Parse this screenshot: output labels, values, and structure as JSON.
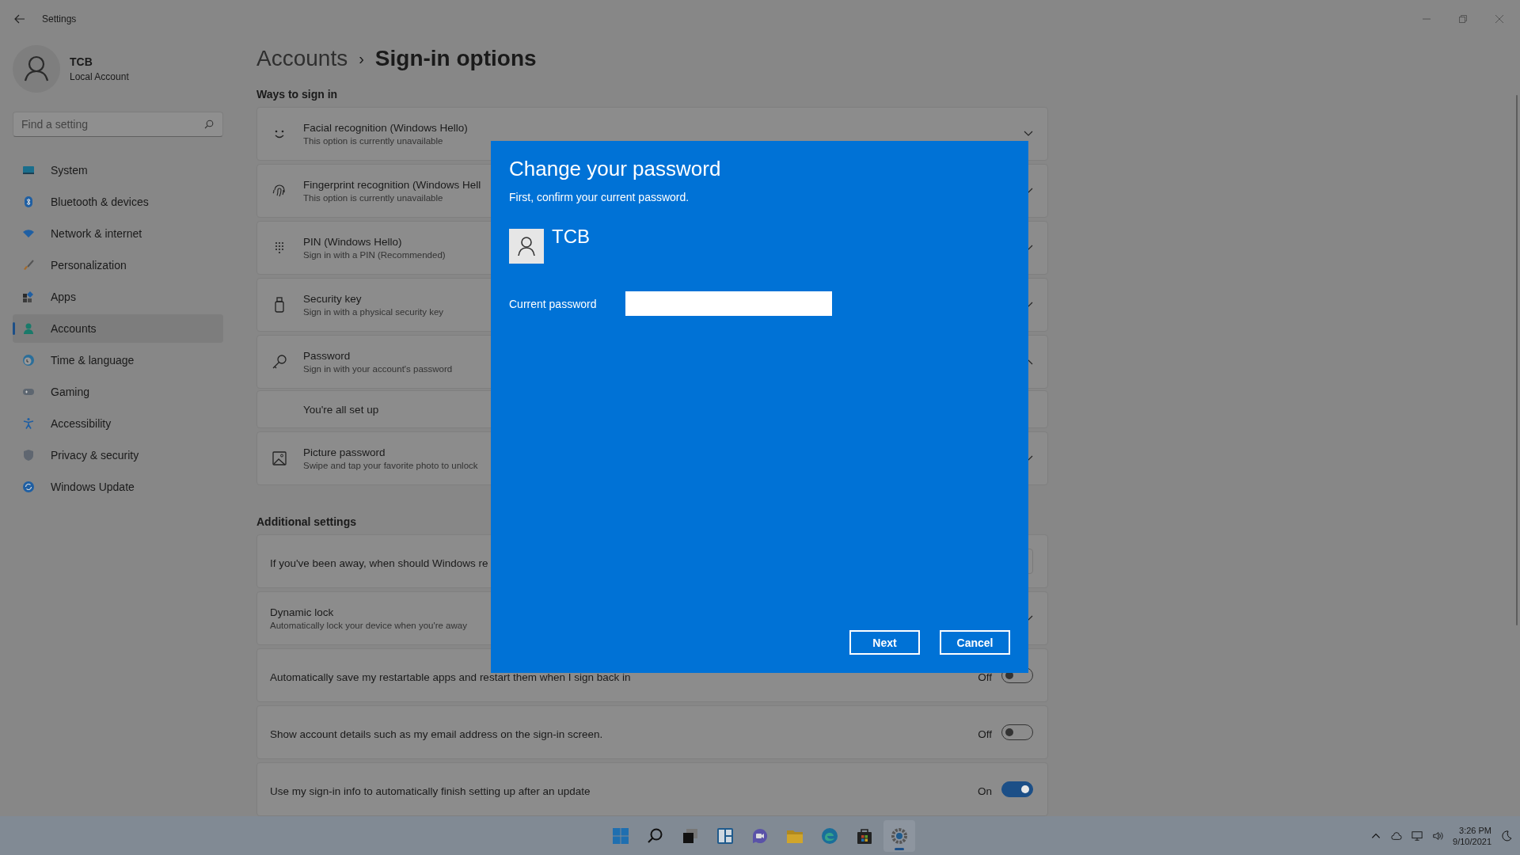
{
  "window": {
    "title": "Settings"
  },
  "profile": {
    "name": "TCB",
    "account_type": "Local Account"
  },
  "search": {
    "placeholder": "Find a setting"
  },
  "nav": [
    {
      "label": "System",
      "kind": "system",
      "selected": false
    },
    {
      "label": "Bluetooth & devices",
      "kind": "bluetooth",
      "selected": false
    },
    {
      "label": "Network & internet",
      "kind": "network",
      "selected": false
    },
    {
      "label": "Personalization",
      "kind": "brush",
      "selected": false
    },
    {
      "label": "Apps",
      "kind": "apps",
      "selected": false
    },
    {
      "label": "Accounts",
      "kind": "accounts",
      "selected": true
    },
    {
      "label": "Time & language",
      "kind": "time",
      "selected": false
    },
    {
      "label": "Gaming",
      "kind": "gaming",
      "selected": false
    },
    {
      "label": "Accessibility",
      "kind": "accessibility",
      "selected": false
    },
    {
      "label": "Privacy & security",
      "kind": "shield",
      "selected": false
    },
    {
      "label": "Windows Update",
      "kind": "update",
      "selected": false
    }
  ],
  "breadcrumb": {
    "parent": "Accounts",
    "separator": "›",
    "current": "Sign-in options"
  },
  "ways_to_sign_in": {
    "heading": "Ways to sign in",
    "options": [
      {
        "kind": "face",
        "title": "Facial recognition (Windows Hello)",
        "subtitle": "This option is currently unavailable",
        "expanded": false
      },
      {
        "kind": "fingerprint",
        "title": "Fingerprint recognition (Windows Hell",
        "subtitle": "This option is currently unavailable",
        "expanded": false
      },
      {
        "kind": "pin",
        "title": "PIN (Windows Hello)",
        "subtitle": "Sign in with a PIN (Recommended)",
        "expanded": false
      },
      {
        "kind": "key",
        "title": "Security key",
        "subtitle": "Sign in with a physical security key",
        "expanded": false
      },
      {
        "kind": "password",
        "title": "Password",
        "subtitle": "Sign in with your account's password",
        "expanded": true,
        "detail": "You're all set up"
      },
      {
        "kind": "picture",
        "title": "Picture password",
        "subtitle": "Swipe and tap your favorite photo to unlock",
        "expanded": false
      }
    ]
  },
  "additional_settings": {
    "heading": "Additional settings",
    "rows": [
      {
        "kind": "dropdown",
        "label": "If you've been away, when should Windows re"
      },
      {
        "kind": "expander",
        "title": "Dynamic lock",
        "subtitle": "Automatically lock your device when you're away",
        "expanded": false
      },
      {
        "kind": "toggle",
        "label": "Automatically save my restartable apps and restart them when I sign back in",
        "on": false,
        "state_text": "Off"
      },
      {
        "kind": "toggle",
        "label": "Show account details such as my email address on the sign-in screen.",
        "on": false,
        "state_text": "Off"
      },
      {
        "kind": "toggle",
        "label": "Use my sign-in info to automatically finish setting up after an update",
        "on": true,
        "state_text": "On"
      }
    ]
  },
  "dialog": {
    "title": "Change your password",
    "subtitle": "First, confirm your current password.",
    "user_name": "TCB",
    "field_label": "Current password",
    "buttons": [
      "Next",
      "Cancel"
    ]
  },
  "taskbar": {
    "apps": [
      {
        "kind": "start",
        "selected": false
      },
      {
        "kind": "search",
        "selected": false
      },
      {
        "kind": "taskview",
        "selected": false
      },
      {
        "kind": "widgets",
        "selected": false
      },
      {
        "kind": "chat",
        "selected": false
      },
      {
        "kind": "explorer",
        "selected": false
      },
      {
        "kind": "edge",
        "selected": false
      },
      {
        "kind": "store",
        "selected": false
      },
      {
        "kind": "settings",
        "selected": true
      }
    ],
    "time": "3:26 PM",
    "date": "9/10/2021"
  }
}
